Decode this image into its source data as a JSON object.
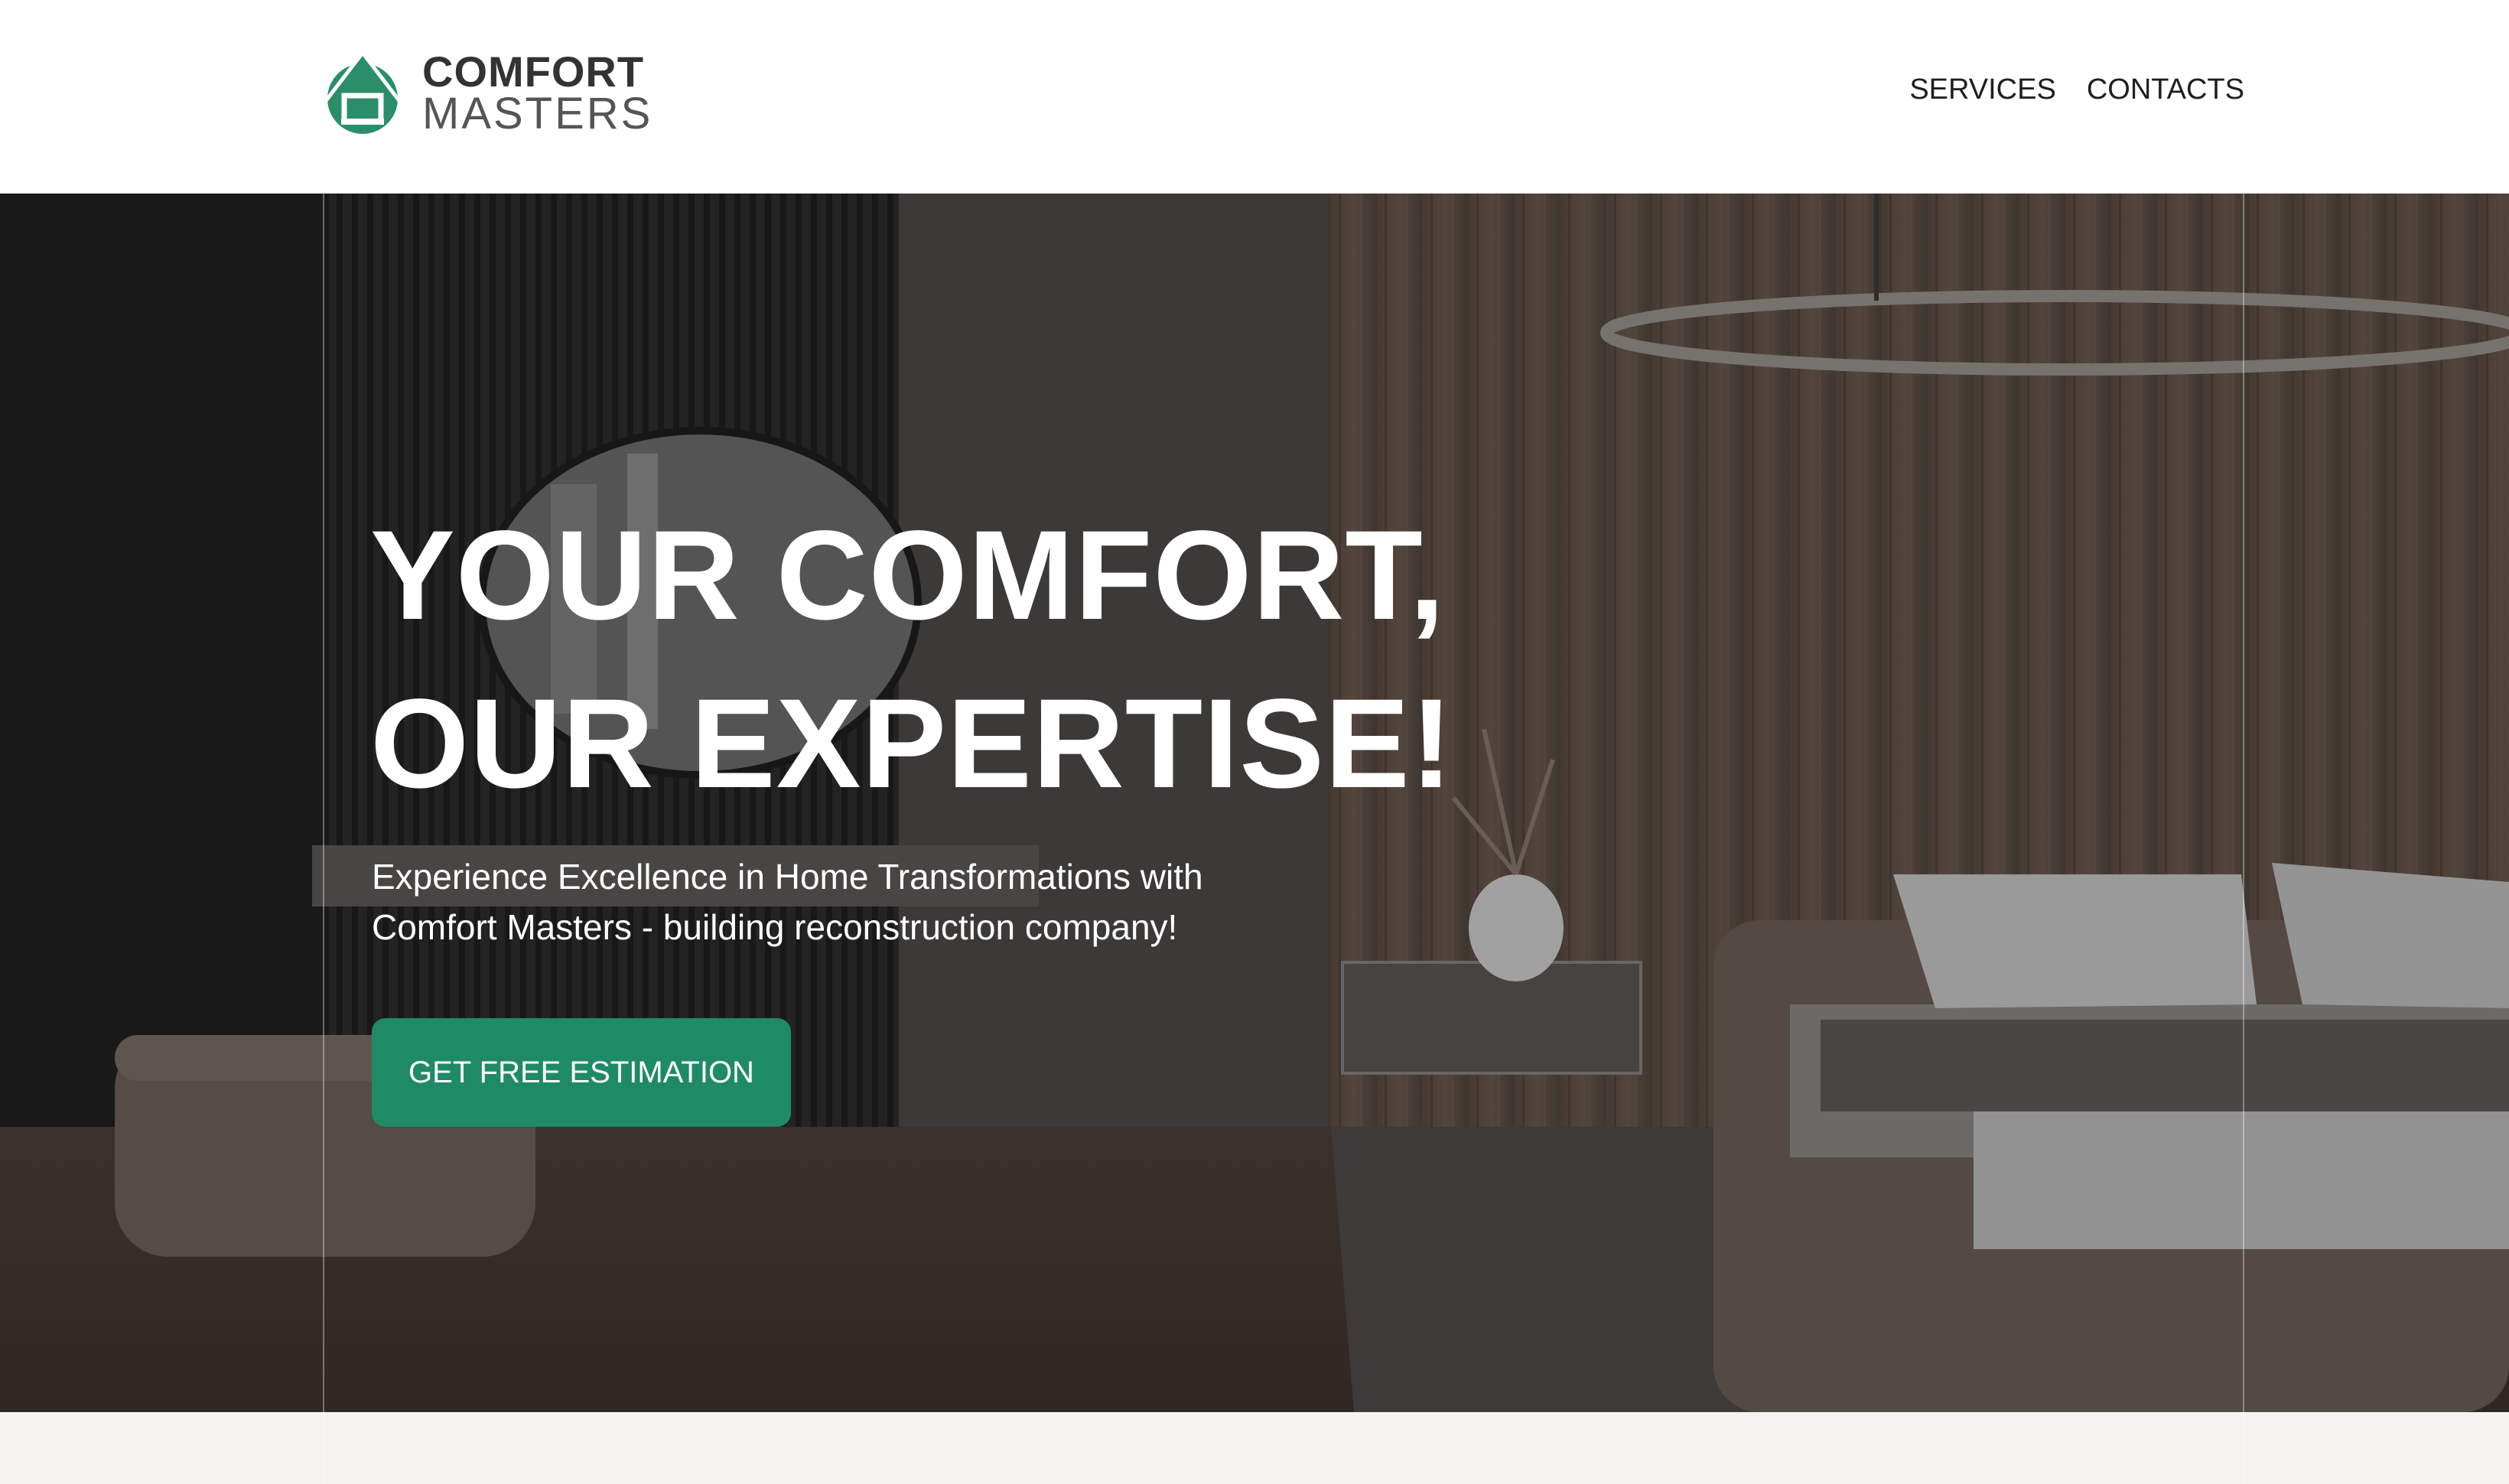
{
  "header": {
    "logo": {
      "line1": "COMFORT",
      "line2": "MASTERS",
      "icon": "house-icon",
      "brand_color": "#2a8f68"
    },
    "nav": [
      {
        "label": "SERVICES"
      },
      {
        "label": "CONTACTS"
      }
    ]
  },
  "hero": {
    "title_line1": "YOUR COMFORT,",
    "title_line2": "OUR EXPERTISE!",
    "subtitle_line1": "Experience Excellence in Home Transformations with",
    "subtitle_line2": "Comfort Masters - building reconstruction company!",
    "cta_label": "GET FREE ESTIMATION",
    "cta_color": "#1f8a66",
    "background": "bedroom-interior-photo"
  },
  "colors": {
    "accent": "#1f8a66",
    "band": "#f5f3f1"
  }
}
